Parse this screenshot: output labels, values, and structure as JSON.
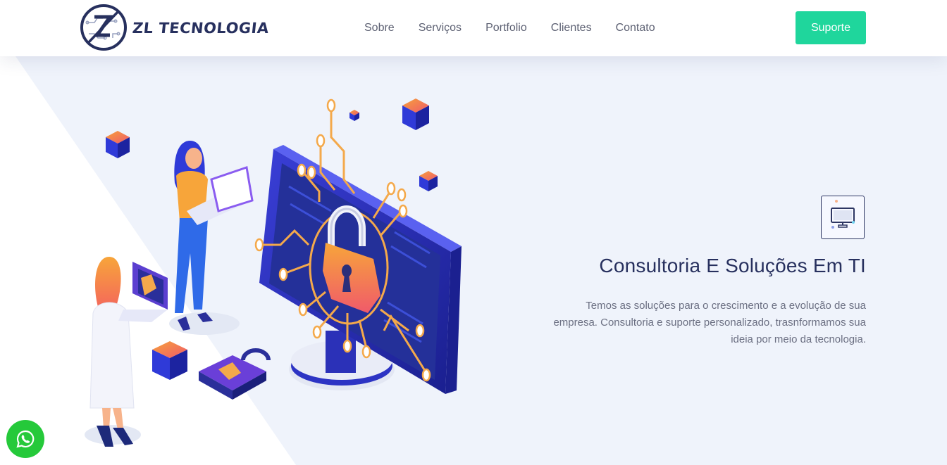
{
  "brand": {
    "name": "ZL TECNOLOGIA",
    "logo_letters": "ZL",
    "accent_color": "#1fd69c",
    "dark_color": "#27305e"
  },
  "nav": {
    "items": [
      {
        "label": "Sobre"
      },
      {
        "label": "Serviços"
      },
      {
        "label": "Portfolio"
      },
      {
        "label": "Clientes"
      },
      {
        "label": "Contato"
      }
    ],
    "support_label": "Suporte"
  },
  "hero": {
    "feature_icon": "monitor-icon",
    "title": "Consultoria E Soluções Em TI",
    "description": "Temos as soluções para o crescimento e a evolução de sua empresa. Consultoria e suporte personalizado, trasnformamos sua ideia por meio da tecnologia.",
    "illustration": "cybersecurity-padlock-illustration"
  },
  "floating": {
    "whatsapp_icon": "whatsapp-icon",
    "whatsapp_color": "#25c93a"
  }
}
